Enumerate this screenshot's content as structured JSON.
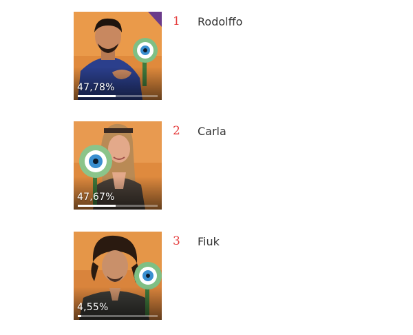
{
  "ranking": [
    {
      "position": "1",
      "name": "Rodolffo",
      "percent_label": "47,78%",
      "progress": 0.4778
    },
    {
      "position": "2",
      "name": "Carla",
      "percent_label": "47,67%",
      "progress": 0.4767
    },
    {
      "position": "3",
      "name": "Fiuk",
      "percent_label": "4,55%",
      "progress": 0.0455
    }
  ],
  "colors": {
    "rank_number": "#e53b3b",
    "name_text": "#333333",
    "progress_fill": "#ffffff"
  },
  "icons": {
    "mascot": "big-brother-eye-mascot-icon"
  }
}
